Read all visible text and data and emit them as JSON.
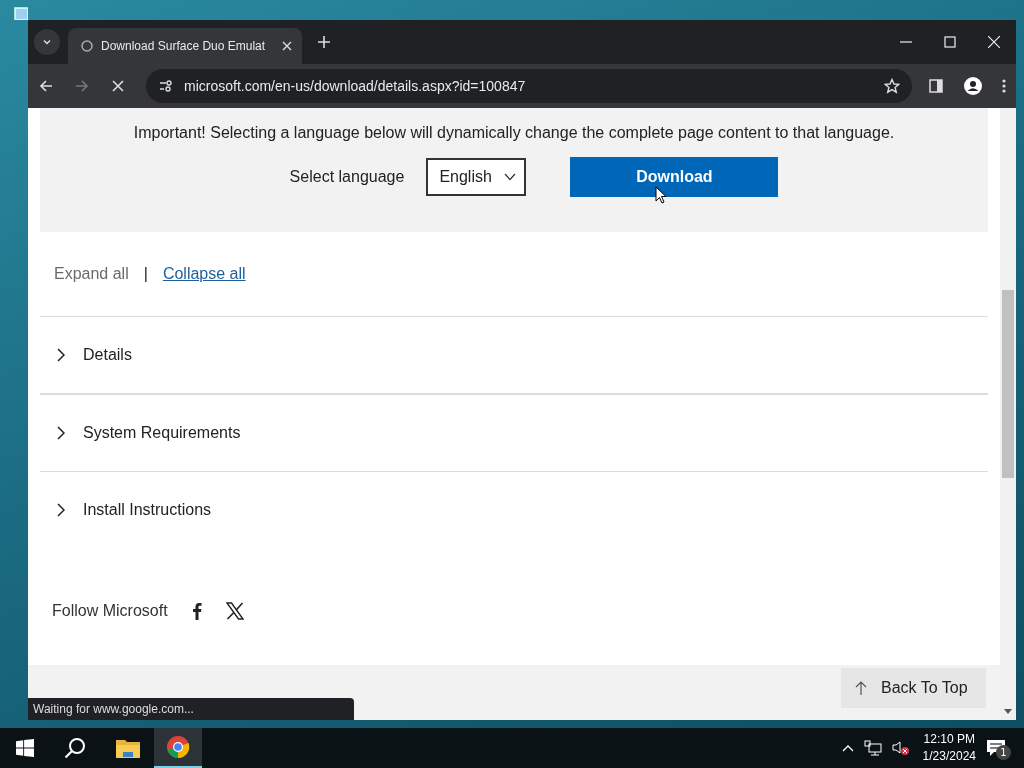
{
  "browser": {
    "tabs": [
      {
        "title": "Download Surface Duo Emulat",
        "selected": true
      }
    ],
    "address": "microsoft.com/en-us/download/details.aspx?id=100847",
    "loading": true
  },
  "page": {
    "notice": "Important! Selecting a language below will dynamically change the complete page content to that language.",
    "language_label": "Select language",
    "language": "English",
    "download_button": "Download",
    "expand_all": "Expand all",
    "separator": "|",
    "collapse_all": "Collapse all",
    "sections": [
      {
        "title": "Details",
        "expanded": false
      },
      {
        "title": "System Requirements",
        "expanded": false
      },
      {
        "title": "Install Instructions",
        "expanded": false
      }
    ],
    "follow_label": "Follow Microsoft",
    "back_to_top": "Back To Top"
  },
  "status_bubble": "Waiting for www.google.com...",
  "taskbar": {
    "time": "12:10 PM",
    "date": "1/23/2024",
    "notifications": "1"
  }
}
